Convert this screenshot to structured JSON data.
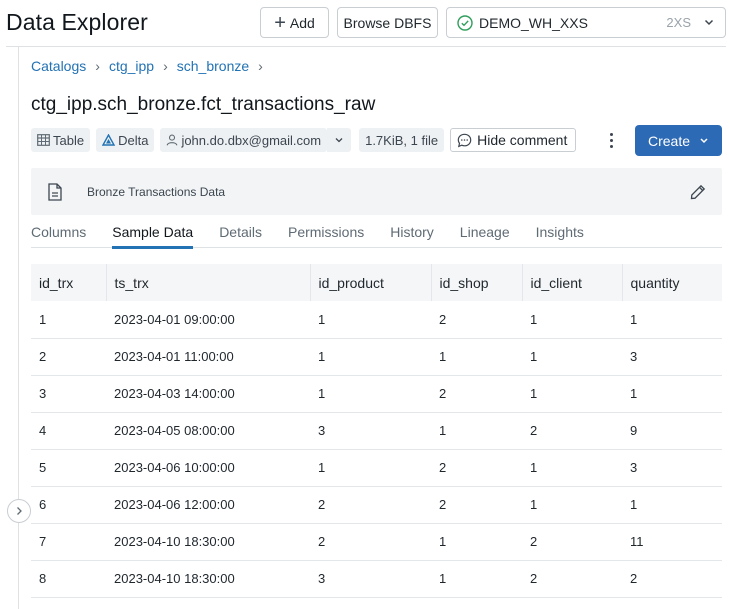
{
  "header": {
    "title": "Data Explorer",
    "add_label": "Add",
    "browse_dbfs_label": "Browse DBFS",
    "warehouse": {
      "name": "DEMO_WH_XXS",
      "size": "2XS",
      "status_color": "#2e9e5b"
    }
  },
  "breadcrumb": [
    "Catalogs",
    "ctg_ipp",
    "sch_bronze"
  ],
  "table": {
    "full_name": "ctg_ipp.sch_bronze.fct_transactions_raw",
    "type_label": "Table",
    "format_label": "Delta",
    "owner": "john.do.dbx@gmail.com",
    "size_label": "1.7KiB, 1 file",
    "hide_comment_label": "Hide comment",
    "create_label": "Create",
    "comment": "Bronze Transactions Data"
  },
  "tabs": [
    {
      "label": "Columns",
      "active": false
    },
    {
      "label": "Sample Data",
      "active": true
    },
    {
      "label": "Details",
      "active": false
    },
    {
      "label": "Permissions",
      "active": false
    },
    {
      "label": "History",
      "active": false
    },
    {
      "label": "Lineage",
      "active": false
    },
    {
      "label": "Insights",
      "active": false
    }
  ],
  "sample": {
    "columns": [
      "id_trx",
      "ts_trx",
      "id_product",
      "id_shop",
      "id_client",
      "quantity"
    ],
    "rows": [
      [
        "1",
        "2023-04-01 09:00:00",
        "1",
        "2",
        "1",
        "1"
      ],
      [
        "2",
        "2023-04-01 11:00:00",
        "1",
        "1",
        "1",
        "3"
      ],
      [
        "3",
        "2023-04-03 14:00:00",
        "1",
        "2",
        "1",
        "1"
      ],
      [
        "4",
        "2023-04-05 08:00:00",
        "3",
        "1",
        "2",
        "9"
      ],
      [
        "5",
        "2023-04-06 10:00:00",
        "1",
        "2",
        "1",
        "3"
      ],
      [
        "6",
        "2023-04-06 12:00:00",
        "2",
        "2",
        "1",
        "1"
      ],
      [
        "7",
        "2023-04-10 18:30:00",
        "2",
        "1",
        "2",
        "11"
      ],
      [
        "8",
        "2023-04-10 18:30:00",
        "3",
        "1",
        "2",
        "2"
      ]
    ]
  },
  "colors": {
    "accent": "#2272b4",
    "primary_button": "#2d6ab5"
  }
}
